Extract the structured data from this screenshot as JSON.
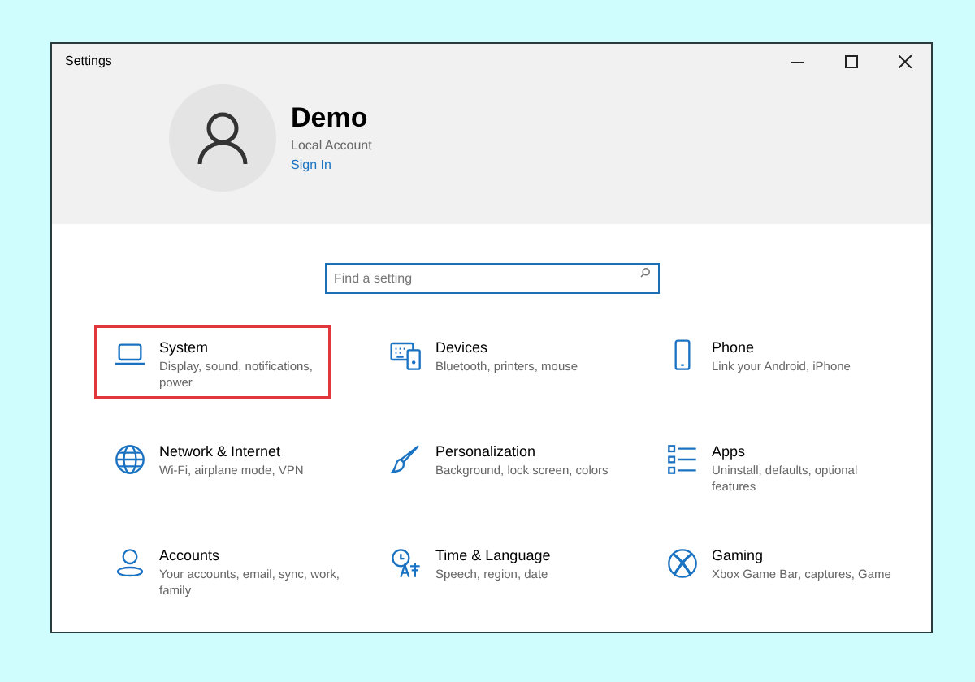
{
  "window": {
    "title": "Settings"
  },
  "account": {
    "name": "Demo",
    "type": "Local Account",
    "link": "Sign In"
  },
  "search": {
    "placeholder": "Find a setting"
  },
  "categories": [
    {
      "kind": "laptop",
      "title": "System",
      "description": "Display, sound, notifications, power",
      "highlighted": true
    },
    {
      "kind": "keyboard",
      "title": "Devices",
      "description": "Bluetooth, printers, mouse",
      "highlighted": false
    },
    {
      "kind": "phone",
      "title": "Phone",
      "description": "Link your Android, iPhone",
      "highlighted": false
    },
    {
      "kind": "globe",
      "title": "Network & Internet",
      "description": "Wi-Fi, airplane mode, VPN",
      "highlighted": false
    },
    {
      "kind": "brush",
      "title": "Personalization",
      "description": "Background, lock screen, colors",
      "highlighted": false
    },
    {
      "kind": "list",
      "title": "Apps",
      "description": "Uninstall, defaults, optional features",
      "highlighted": false
    },
    {
      "kind": "person",
      "title": "Accounts",
      "description": "Your accounts, email, sync, work, family",
      "highlighted": false
    },
    {
      "kind": "language",
      "title": "Time & Language",
      "description": "Speech, region, date",
      "highlighted": false
    },
    {
      "kind": "xbox",
      "title": "Gaming",
      "description": "Xbox Game Bar, captures, Game",
      "highlighted": false
    }
  ]
}
